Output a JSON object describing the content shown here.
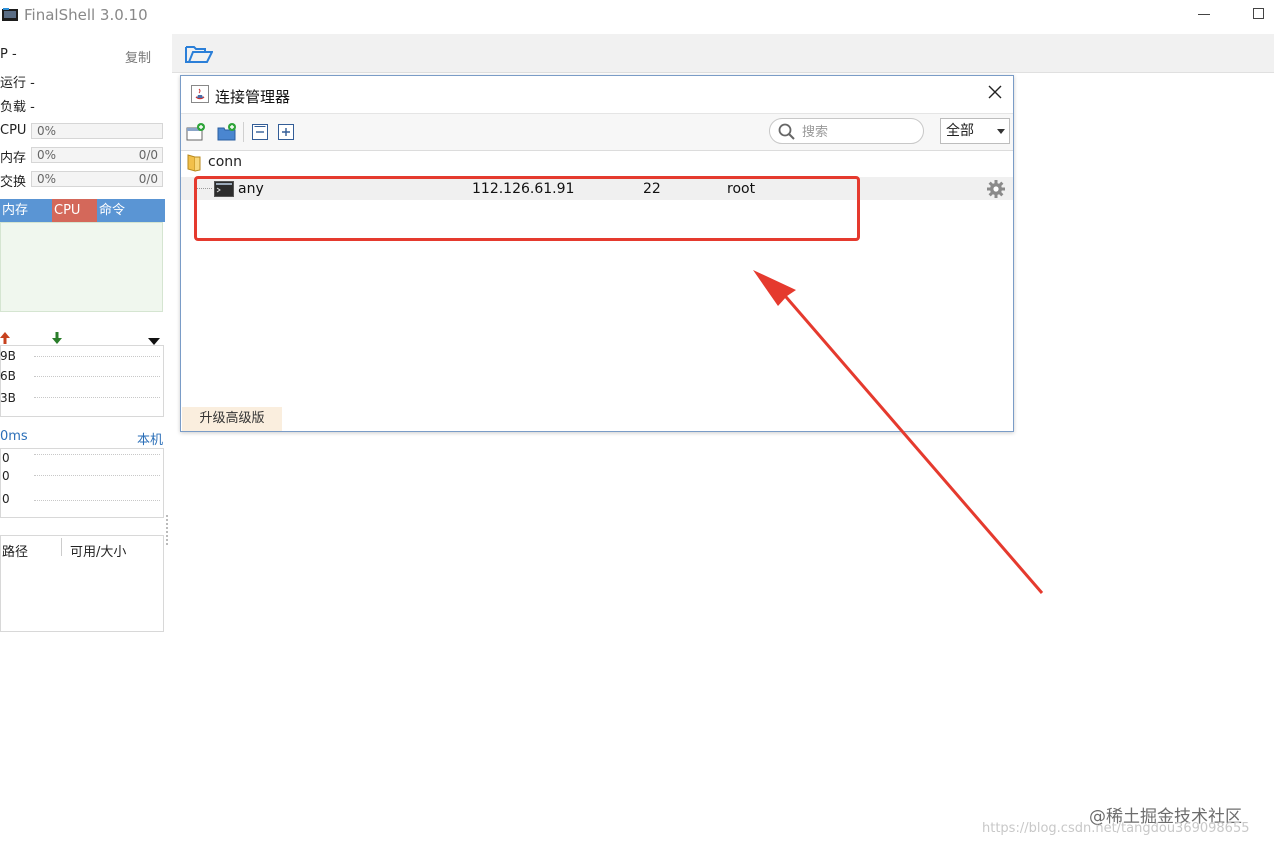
{
  "window": {
    "title": "FinalShell 3.0.10"
  },
  "left_panel": {
    "ip_label": "P -",
    "copy_button": "复制",
    "run_label": "运行 -",
    "load_label": "负载 -",
    "cpu": {
      "label": "CPU",
      "value": "0%"
    },
    "mem": {
      "label": "内存",
      "value": "0%",
      "ratio": "0/0"
    },
    "swap": {
      "label": "交换",
      "value": "0%",
      "ratio": "0/0"
    },
    "tabs": [
      {
        "label": "内存"
      },
      {
        "label": "CPU"
      },
      {
        "label": "命令"
      }
    ],
    "net_ticks": [
      "9B",
      "6B",
      "3B"
    ],
    "ping": {
      "label": "0ms",
      "host": "本机"
    },
    "ping_ticks": [
      "0",
      "0",
      "0"
    ],
    "disk_headers": [
      "路径",
      "可用/大小"
    ]
  },
  "dialog": {
    "title": "连接管理器",
    "search": {
      "placeholder": "搜索"
    },
    "filter": {
      "selected": "全部"
    },
    "tree": {
      "folder": "conn",
      "connections": [
        {
          "name": "any",
          "host": "112.126.61.91",
          "port": "22",
          "user": "root"
        }
      ]
    },
    "upgrade_button": "升级高级版"
  },
  "colors": {
    "tab_mem": "#5a95d4",
    "tab_cpu": "#d4685a",
    "tab_cmd": "#5a95d4",
    "highlight": "#e53a2e",
    "dialog_border": "#7a9cc7"
  },
  "watermark": {
    "line1": "@稀土掘金技术社区",
    "line2": "https://blog.csdn.net/tangdou369098655"
  }
}
